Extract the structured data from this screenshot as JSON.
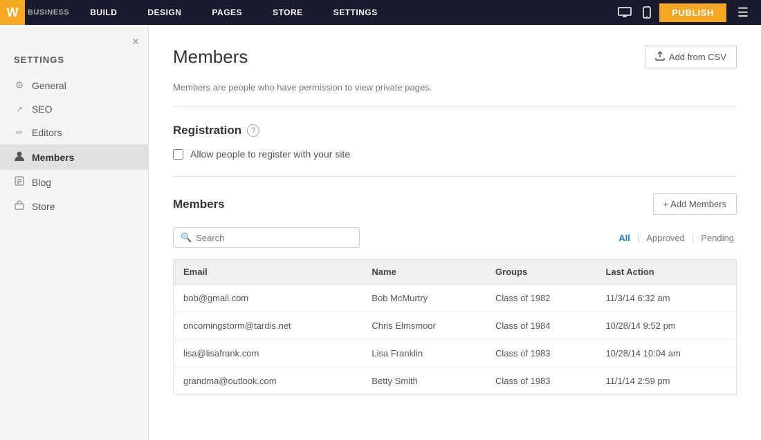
{
  "topNav": {
    "logo": "W",
    "logoAlt": "Weebly",
    "items": [
      {
        "label": "BUILD",
        "id": "build"
      },
      {
        "label": "DESIGN",
        "id": "design"
      },
      {
        "label": "PAGES",
        "id": "pages"
      },
      {
        "label": "STORE",
        "id": "store"
      },
      {
        "label": "SETTINGS",
        "id": "settings",
        "active": true
      }
    ],
    "publishLabel": "PUBLISH",
    "businessLabel": "BUSINESS"
  },
  "sidebar": {
    "title": "SETTINGS",
    "items": [
      {
        "label": "General",
        "icon": "⚙",
        "id": "general"
      },
      {
        "label": "SEO",
        "icon": "↗",
        "id": "seo"
      },
      {
        "label": "Editors",
        "icon": "✏",
        "id": "editors"
      },
      {
        "label": "Members",
        "icon": "👤",
        "id": "members",
        "active": true
      },
      {
        "label": "Blog",
        "icon": "💬",
        "id": "blog"
      },
      {
        "label": "Store",
        "icon": "🛒",
        "id": "store"
      }
    ]
  },
  "main": {
    "title": "Members",
    "addFromCsvLabel": "Add from CSV",
    "descriptionText": "Members are people who have permission to view private pages.",
    "registration": {
      "sectionTitle": "Registration",
      "checkboxLabel": "Allow people to register with your site"
    },
    "membersSection": {
      "sectionTitle": "Members",
      "addMembersLabel": "+ Add Members",
      "search": {
        "placeholder": "Search"
      },
      "filters": [
        {
          "label": "All",
          "active": true
        },
        {
          "label": "Approved",
          "active": false
        },
        {
          "label": "Pending",
          "active": false
        }
      ],
      "tableHeaders": [
        "Email",
        "Name",
        "Groups",
        "Last Action"
      ],
      "members": [
        {
          "email": "bob@gmail.com",
          "name": "Bob McMurtry",
          "groups": "Class of 1982",
          "lastAction": "11/3/14 6:32 am"
        },
        {
          "email": "oncomingstorm@tardis.net",
          "name": "Chris Elmsmoor",
          "groups": "Class of 1984",
          "lastAction": "10/28/14 9:52 pm"
        },
        {
          "email": "lisa@lisafrank.com",
          "name": "Lisa Franklin",
          "groups": "Class of 1983",
          "lastAction": "10/28/14 10:04 am"
        },
        {
          "email": "grandma@outlook.com",
          "name": "Betty Smith",
          "groups": "Class of 1983",
          "lastAction": "11/1/14 2:59 pm"
        }
      ]
    }
  },
  "colors": {
    "navBg": "#1c2033",
    "logoColor": "#f5a623",
    "activeBlue": "#1a7ec8"
  }
}
